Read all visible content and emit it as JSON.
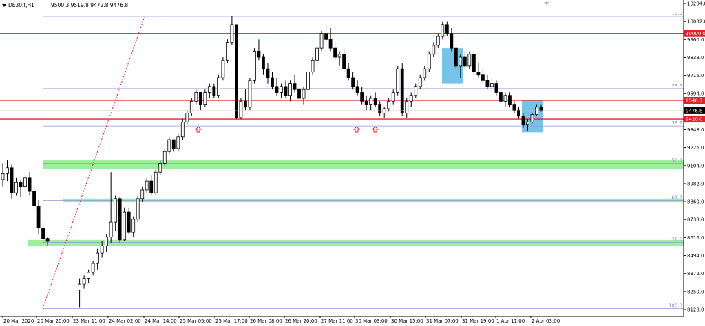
{
  "header": {
    "symbol": "DE30.f,H1",
    "ohlc": "9500.3 9519.8 9472.8 9476.8"
  },
  "chart_data": {
    "type": "candlestick",
    "symbol": "DE30.f",
    "timeframe": "H1",
    "ylim": [
      8128.0,
      10204.0
    ],
    "y_ticks": [
      "10204.0",
      "10082.0",
      "9960.0",
      "9838.0",
      "9716.0",
      "9594.0",
      "9476.8",
      "9348.0",
      "9226.0",
      "9104.0",
      "8982.0",
      "8860.0",
      "8738.0",
      "8616.0",
      "8494.0",
      "8372.0",
      "8250.0",
      "8128.0"
    ],
    "x_ticks": [
      "20 Mar 2020",
      "20 Mar 20:00",
      "23 Mar 11:00",
      "24 Mar 02:00",
      "24 Mar 14:00",
      "25 Mar 05:00",
      "25 Mar 17:00",
      "26 Mar 08:00",
      "26 Mar 20:00",
      "27 Mar 11:00",
      "30 Mar 03:00",
      "30 Mar 15:00",
      "31 Mar 07:00",
      "31 Mar 19:00",
      "1 Apr 11:00",
      "2 Apr 03:00"
    ],
    "current_price": "9476.8",
    "horizontal_lines": [
      {
        "label": "10000.0",
        "value": 10000.0,
        "color": "#e0202a"
      },
      {
        "label": "9546.3",
        "value": 9546.3,
        "color": "#e0202a"
      },
      {
        "label": "9420.0",
        "value": 9420.0,
        "color": "#e0202a"
      }
    ],
    "fibonacci_levels": [
      {
        "label": "0.0",
        "value": 10115.0
      },
      {
        "label": "23.6",
        "value": 9626.0
      },
      {
        "label": "38.2",
        "value": 9373.0
      },
      {
        "label": "50.0",
        "value": 9120.0
      },
      {
        "label": "61.8",
        "value": 8867.0
      },
      {
        "label": "78.6",
        "value": 8582.0
      },
      {
        "label": "100.0",
        "value": 8135.0
      }
    ],
    "green_zones": [
      {
        "from": 9080.0,
        "to": 9140.0
      },
      {
        "from": 8860.0,
        "to": 8880.0
      },
      {
        "from": 8560.0,
        "to": 8600.0
      }
    ],
    "blue_boxes": [
      {
        "from": 9660.0,
        "to": 9900.0
      },
      {
        "from": 9330.0,
        "to": 9545.0
      }
    ],
    "candles": [
      [
        9010,
        9120,
        8960,
        9050
      ],
      [
        9050,
        9140,
        9000,
        9090
      ],
      [
        9090,
        9110,
        8880,
        8920
      ],
      [
        8920,
        9020,
        8900,
        8990
      ],
      [
        8990,
        9010,
        8890,
        8960
      ],
      [
        8960,
        9040,
        8920,
        9020
      ],
      [
        9020,
        9060,
        8900,
        8930
      ],
      [
        8930,
        8970,
        8800,
        8830
      ],
      [
        8830,
        8870,
        8640,
        8680
      ],
      [
        8680,
        8720,
        8580,
        8610
      ],
      [
        8610,
        8620,
        8560,
        8590
      ],
      [
        8260,
        8340,
        8140,
        8300
      ],
      [
        8300,
        8360,
        8270,
        8340
      ],
      [
        8340,
        8400,
        8310,
        8380
      ],
      [
        8380,
        8460,
        8360,
        8440
      ],
      [
        8440,
        8540,
        8400,
        8510
      ],
      [
        8510,
        8590,
        8480,
        8560
      ],
      [
        8560,
        8640,
        8520,
        8620
      ],
      [
        8620,
        9060,
        8580,
        8720
      ],
      [
        8720,
        8900,
        8660,
        8880
      ],
      [
        8880,
        8890,
        8580,
        8600
      ],
      [
        8600,
        8820,
        8590,
        8790
      ],
      [
        8790,
        8820,
        8640,
        8650
      ],
      [
        8650,
        8760,
        8620,
        8740
      ],
      [
        8740,
        8900,
        8720,
        8880
      ],
      [
        8880,
        8960,
        8860,
        8940
      ],
      [
        8940,
        9020,
        8920,
        9000
      ],
      [
        9000,
        9040,
        8900,
        8920
      ],
      [
        8920,
        9080,
        8900,
        9060
      ],
      [
        9060,
        9140,
        9040,
        9120
      ],
      [
        9120,
        9220,
        9100,
        9200
      ],
      [
        9200,
        9300,
        9180,
        9280
      ],
      [
        9280,
        9260,
        9200,
        9220
      ],
      [
        9220,
        9320,
        9200,
        9300
      ],
      [
        9300,
        9420,
        9280,
        9400
      ],
      [
        9400,
        9480,
        9380,
        9460
      ],
      [
        9460,
        9560,
        9440,
        9540
      ],
      [
        9540,
        9620,
        9520,
        9600
      ],
      [
        9600,
        9600,
        9480,
        9520
      ],
      [
        9520,
        9620,
        9500,
        9600
      ],
      [
        9600,
        9660,
        9560,
        9640
      ],
      [
        9640,
        9660,
        9560,
        9580
      ],
      [
        9580,
        9720,
        9560,
        9700
      ],
      [
        9700,
        9840,
        9680,
        9820
      ],
      [
        9820,
        9960,
        9800,
        9940
      ],
      [
        9940,
        10120,
        9920,
        10060
      ],
      [
        10060,
        10060,
        9420,
        9430
      ],
      [
        9430,
        9560,
        9420,
        9540
      ],
      [
        9540,
        9620,
        9480,
        9500
      ],
      [
        9500,
        9700,
        9480,
        9680
      ],
      [
        9680,
        9900,
        9660,
        9880
      ],
      [
        9880,
        9960,
        9820,
        9840
      ],
      [
        9840,
        9860,
        9720,
        9760
      ],
      [
        9760,
        9800,
        9660,
        9700
      ],
      [
        9700,
        9740,
        9620,
        9640
      ],
      [
        9640,
        9700,
        9580,
        9600
      ],
      [
        9600,
        9660,
        9560,
        9640
      ],
      [
        9640,
        9680,
        9560,
        9580
      ],
      [
        9580,
        9680,
        9540,
        9660
      ],
      [
        9660,
        9720,
        9600,
        9620
      ],
      [
        9620,
        9680,
        9540,
        9560
      ],
      [
        9560,
        9640,
        9520,
        9620
      ],
      [
        9620,
        9760,
        9600,
        9740
      ],
      [
        9740,
        9840,
        9720,
        9820
      ],
      [
        9820,
        9920,
        9780,
        9900
      ],
      [
        9900,
        10020,
        9880,
        10000
      ],
      [
        10000,
        10060,
        9940,
        9960
      ],
      [
        9960,
        10040,
        9880,
        9900
      ],
      [
        9900,
        9940,
        9820,
        9840
      ],
      [
        9840,
        9880,
        9780,
        9860
      ],
      [
        9860,
        9900,
        9740,
        9760
      ],
      [
        9760,
        9800,
        9680,
        9700
      ],
      [
        9700,
        9740,
        9620,
        9640
      ],
      [
        9640,
        9680,
        9580,
        9600
      ],
      [
        9600,
        9640,
        9520,
        9540
      ],
      [
        9540,
        9580,
        9480,
        9520
      ],
      [
        9520,
        9580,
        9480,
        9560
      ],
      [
        9560,
        9600,
        9500,
        9520
      ],
      [
        9520,
        9540,
        9440,
        9460
      ],
      [
        9460,
        9500,
        9430,
        9490
      ],
      [
        9490,
        9560,
        9470,
        9540
      ],
      [
        9540,
        9620,
        9520,
        9600
      ],
      [
        9600,
        9780,
        9580,
        9760
      ],
      [
        9760,
        9800,
        9440,
        9460
      ],
      [
        9460,
        9560,
        9430,
        9540
      ],
      [
        9540,
        9600,
        9500,
        9580
      ],
      [
        9580,
        9660,
        9560,
        9640
      ],
      [
        9640,
        9720,
        9620,
        9700
      ],
      [
        9700,
        9780,
        9680,
        9760
      ],
      [
        9760,
        9880,
        9740,
        9860
      ],
      [
        9860,
        9940,
        9840,
        9920
      ],
      [
        9920,
        10000,
        9900,
        9980
      ],
      [
        9980,
        10080,
        9960,
        10060
      ],
      [
        10060,
        10080,
        9980,
        10000
      ],
      [
        10000,
        10040,
        9880,
        9900
      ],
      [
        9900,
        9900,
        9760,
        9780
      ],
      [
        9780,
        9860,
        9700,
        9840
      ],
      [
        9840,
        9880,
        9760,
        9780
      ],
      [
        9780,
        9880,
        9760,
        9860
      ],
      [
        9860,
        9880,
        9720,
        9740
      ],
      [
        9740,
        9800,
        9700,
        9720
      ],
      [
        9720,
        9760,
        9660,
        9680
      ],
      [
        9680,
        9720,
        9620,
        9640
      ],
      [
        9640,
        9700,
        9600,
        9660
      ],
      [
        9660,
        9680,
        9580,
        9600
      ],
      [
        9600,
        9620,
        9520,
        9540
      ],
      [
        9540,
        9600,
        9500,
        9580
      ],
      [
        9580,
        9600,
        9500,
        9520
      ],
      [
        9520,
        9540,
        9460,
        9480
      ],
      [
        9480,
        9500,
        9420,
        9440
      ],
      [
        9440,
        9460,
        9360,
        9380
      ],
      [
        9380,
        9420,
        9340,
        9400
      ],
      [
        9400,
        9460,
        9390,
        9450
      ],
      [
        9450,
        9520,
        9440,
        9500
      ],
      [
        9500,
        9520,
        9470,
        9477
      ]
    ]
  }
}
